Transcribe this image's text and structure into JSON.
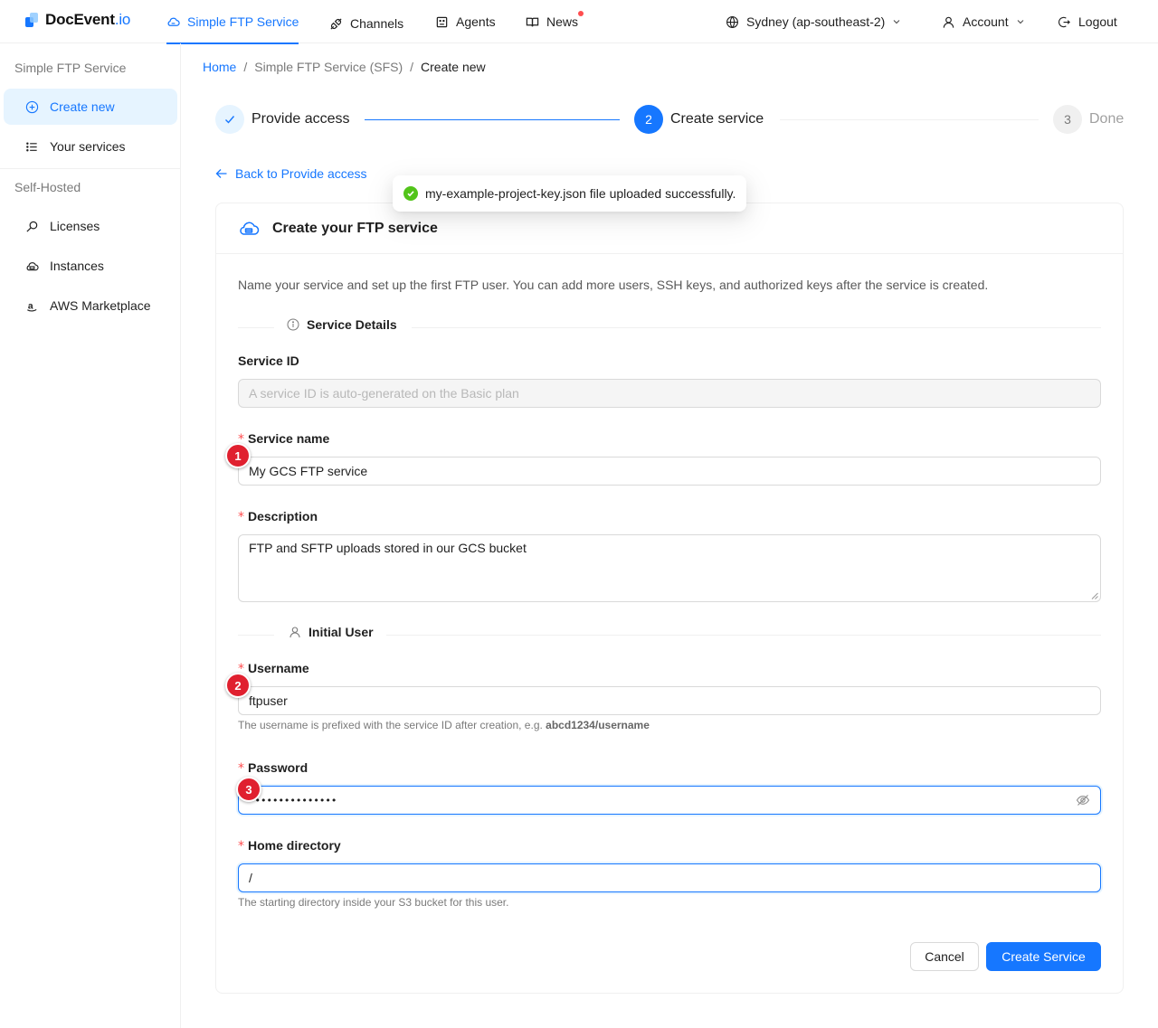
{
  "app": {
    "logo_main": "DocEvent",
    "logo_suffix": ".io"
  },
  "topnav": {
    "items": [
      {
        "label": "Simple FTP Service",
        "icon": "cloud-icon",
        "active": true
      },
      {
        "label": "Channels",
        "icon": "api-icon"
      },
      {
        "label": "Agents",
        "icon": "robot-icon"
      },
      {
        "label": "News",
        "icon": "book-icon",
        "has_dot": true
      }
    ],
    "region": "Sydney (ap-southeast-2)",
    "account": "Account",
    "logout": "Logout"
  },
  "sidebar": {
    "group1": "Simple FTP Service",
    "items1": [
      {
        "label": "Create new",
        "icon": "plus-circle-icon",
        "active": true
      },
      {
        "label": "Your services",
        "icon": "list-icon"
      }
    ],
    "group2": "Self-Hosted",
    "items2": [
      {
        "label": "Licenses",
        "icon": "key-icon"
      },
      {
        "label": "Instances",
        "icon": "cloud-server-icon"
      },
      {
        "label": "AWS Marketplace",
        "icon": "amazon-icon"
      }
    ]
  },
  "breadcrumb": {
    "home": "Home",
    "section": "Simple FTP Service (SFS)",
    "current": "Create new"
  },
  "steps": [
    {
      "title": "Provide access",
      "status": "finish"
    },
    {
      "number": "2",
      "title": "Create service",
      "status": "process"
    },
    {
      "number": "3",
      "title": "Done",
      "status": "wait"
    }
  ],
  "back_link": "Back to Provide access",
  "toast": "my-example-project-key.json file uploaded successfully.",
  "card": {
    "title": "Create your FTP service",
    "intro": "Name your service and set up the first FTP user. You can add more users, SSH keys, and authorized keys after the service is created.",
    "section_details": "Service Details",
    "service_id": {
      "label": "Service ID",
      "placeholder": "A service ID is auto-generated on the Basic plan"
    },
    "service_name": {
      "label": "Service name",
      "value": "My GCS FTP service",
      "marker": "1"
    },
    "description": {
      "label": "Description",
      "value": "FTP and SFTP uploads stored in our GCS bucket"
    },
    "section_user": "Initial User",
    "username": {
      "label": "Username",
      "value": "ftpuser",
      "marker": "2",
      "help_prefix": "The username is prefixed with the service ID after creation, e.g. ",
      "help_example": "abcd1234/username"
    },
    "password": {
      "label": "Password",
      "masked_value": "•••••••••••••••",
      "marker": "3"
    },
    "home_directory": {
      "label": "Home directory",
      "value": "/",
      "help": "The starting directory inside your S3 bucket for this user."
    },
    "cancel": "Cancel",
    "submit": "Create Service"
  },
  "colors": {
    "primary": "#1677ff",
    "marker": "#e0202f",
    "success": "#52c41a",
    "required": "#ff4d4f"
  }
}
